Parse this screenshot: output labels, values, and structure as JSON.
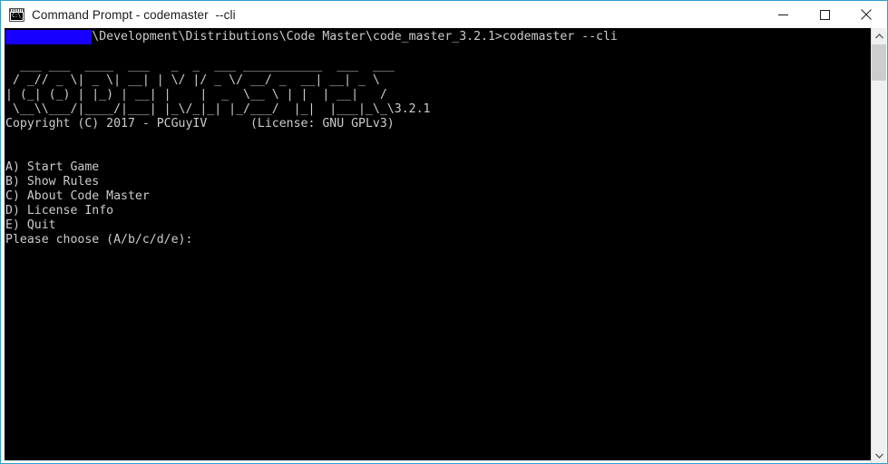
{
  "window": {
    "title": "Command Prompt - codemaster  --cli",
    "icon_name": "command-prompt-icon",
    "icon_glyph": "C:\\_",
    "border_color": "#2f9fd0",
    "background_color": "#000000",
    "foreground_color": "#cccccc"
  },
  "caption": {
    "minimize_label": "Minimize",
    "maximize_label": "Maximize",
    "close_label": "Close"
  },
  "console": {
    "prompt": {
      "redacted_path": "            ",
      "path_visible": "\\Development\\Distributions\\Code Master\\code_master_3.2.1>",
      "command": "codemaster --cli",
      "redaction_color": "#1600ff"
    },
    "banner": {
      "line1": "  ___ ___  ____  ___   _  _  ___ ___________  ___  ___",
      "line2": " / _// _ \\| _ \\| __| | \\/ |/ _ \\/ __/ _  __| __| _ \\",
      "line3": "| (_| (_) | |_) | __| |    |  _  \\__ \\ | |  | __|   /",
      "line4": " \\__\\\\___/|____/|___| |_\\/_|_| |_/___/  |_|  |___|_\\_\\",
      "version": "3.2.1"
    },
    "copyright": "Copyright (C) 2017 - PCGuyIV      (License: GNU GPLv3)",
    "menu": [
      "A) Start Game",
      "B) Show Rules",
      "C) About Code Master",
      "D) License Info",
      "E) Quit"
    ],
    "prompt_choose": "Please choose (A/b/c/d/e):"
  },
  "scrollbar": {
    "up_arrow_name": "scroll-up-arrow",
    "down_arrow_name": "scroll-down-arrow",
    "thumb_name": "scroll-thumb"
  }
}
